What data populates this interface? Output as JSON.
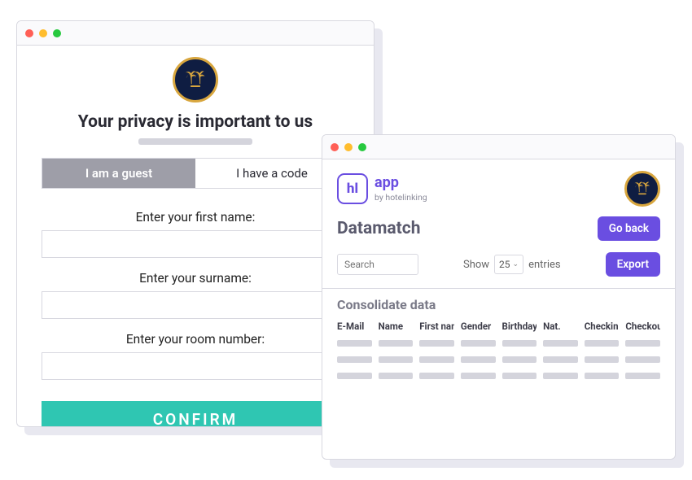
{
  "left": {
    "title": "Your privacy is important to us",
    "tabs": {
      "guest": "I am a guest",
      "code": "I have a code"
    },
    "fields": {
      "first": "Enter your first name:",
      "last": "Enter your surname:",
      "room": "Enter your room number:"
    },
    "confirm": "CONFIRM"
  },
  "right": {
    "app": {
      "name": "app",
      "by": "by hotelinking",
      "icon_text": "hl"
    },
    "section": "Datamatch",
    "goback": "Go back",
    "search_placeholder": "Search",
    "show": {
      "label": "Show",
      "value": "25",
      "entries": "entries"
    },
    "export": "Export",
    "consolidate": "Consolidate data",
    "columns": [
      "E-Mail",
      "Name",
      "First name",
      "Gender",
      "Birthday",
      "Nat.",
      "Checkin",
      "Checkout"
    ]
  },
  "colors": {
    "purple": "#6a4ee1",
    "teal": "#2fc6b2",
    "navy": "#0f1d42",
    "gold": "#d8a63e"
  }
}
